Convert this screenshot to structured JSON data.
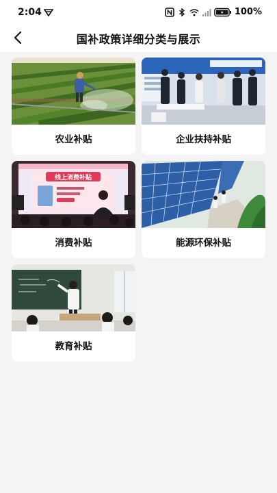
{
  "status_bar": {
    "time": "2:04",
    "battery": "100%"
  },
  "header": {
    "title": "国补政策详细分类与展示"
  },
  "categories": [
    {
      "label": "农业补贴",
      "image": "farm-sprinkler-photo"
    },
    {
      "label": "企业扶持补贴",
      "image": "business-expo-photo"
    },
    {
      "label": "消费补贴",
      "image": "livestream-promo-photo",
      "image_text": "线上消费补贴"
    },
    {
      "label": "能源环保补贴",
      "image": "solar-panel-field-photo"
    },
    {
      "label": "教育补贴",
      "image": "classroom-photo"
    }
  ]
}
